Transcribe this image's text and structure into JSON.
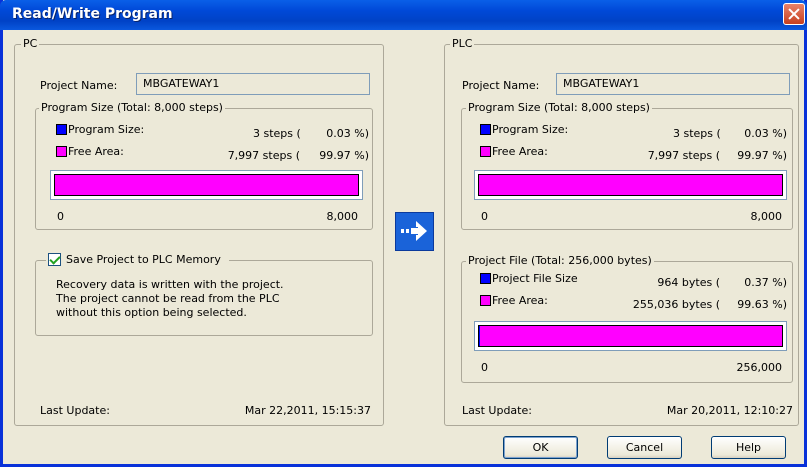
{
  "window": {
    "title": "Read/Write Program"
  },
  "pc": {
    "title": "PC",
    "project_name_label": "Project Name:",
    "project_name": "MBGATEWAY1",
    "program_size": {
      "title": "Program Size (Total: 8,000 steps)",
      "program_label": "Program Size:",
      "program_value": "3 steps (",
      "program_pct": "0.03 %)",
      "free_label": "Free Area:",
      "free_value": "7,997 steps (",
      "free_pct": "99.97 %)",
      "bar_fraction_used": 0.0004,
      "axis_min": "0",
      "axis_max": "8,000"
    },
    "save_option": {
      "label": "Save Project to PLC Memory",
      "checked": true,
      "desc1": "Recovery data is written with the project.",
      "desc2": "The project cannot be read from the PLC",
      "desc3": "without this option being selected."
    },
    "last_update_label": "Last Update:",
    "last_update": "Mar 22,2011, 15:15:37"
  },
  "plc": {
    "title": "PLC",
    "project_name_label": "Project Name:",
    "project_name": "MBGATEWAY1",
    "program_size": {
      "title": "Program Size (Total: 8,000 steps)",
      "program_label": "Program Size:",
      "program_value": "3 steps (",
      "program_pct": "0.03 %)",
      "free_label": "Free Area:",
      "free_value": "7,997 steps (",
      "free_pct": "99.97 %)",
      "bar_fraction_used": 0.0004,
      "axis_min": "0",
      "axis_max": "8,000"
    },
    "project_file": {
      "title": "Project File (Total: 256,000 bytes)",
      "file_label": "Project File Size",
      "file_value": "964 bytes (",
      "file_pct": "0.37 %)",
      "free_label": "Free Area:",
      "free_value": "255,036 bytes (",
      "free_pct": "99.63 %)",
      "bar_fraction_used": 0.0037,
      "axis_min": "0",
      "axis_max": "256,000"
    },
    "last_update_label": "Last Update:",
    "last_update": "Mar 20,2011, 12:10:27"
  },
  "transfer_icon": "right-arrow-icon",
  "buttons": {
    "ok": "OK",
    "cancel": "Cancel",
    "help": "Help"
  },
  "colors": {
    "used": "#0000ff",
    "free": "#ff00ff",
    "titlebar": "#0049d8"
  }
}
